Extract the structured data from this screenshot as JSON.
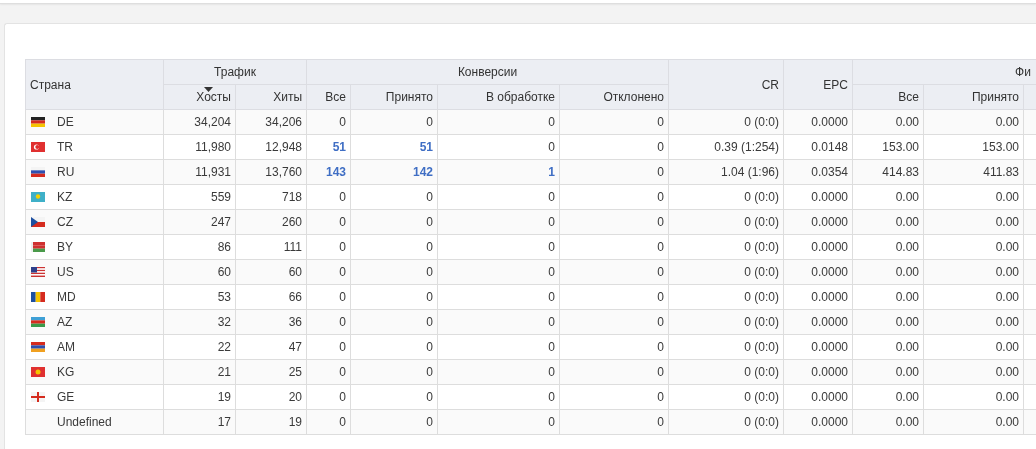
{
  "table": {
    "groups": [
      {
        "label": "Страна",
        "kind": "single"
      },
      {
        "label": "Трафик",
        "kind": "group"
      },
      {
        "label": "Конверсии",
        "kind": "group"
      },
      {
        "label": "CR",
        "kind": "single"
      },
      {
        "label": "EPC",
        "kind": "single"
      },
      {
        "label": "Фи",
        "kind": "group"
      }
    ],
    "columns": [
      {
        "label": "Хосты",
        "sorted": true
      },
      {
        "label": "Хиты",
        "sorted": false
      },
      {
        "label": "Все",
        "sorted": false
      },
      {
        "label": "Принято",
        "sorted": false
      },
      {
        "label": "В обработке",
        "sorted": false
      },
      {
        "label": "Отклонено",
        "sorted": false
      },
      {
        "label": "Все",
        "sorted": false
      },
      {
        "label": "Принято",
        "sorted": false
      }
    ],
    "rows": [
      {
        "country": "DE",
        "kind": "de",
        "hosts": "34,204",
        "hits": "34,206",
        "conversions": [
          {
            "text": "0",
            "link": false
          },
          {
            "text": "0",
            "link": false
          },
          {
            "text": "0",
            "link": false
          },
          {
            "text": "0",
            "link": false
          }
        ],
        "cr": "0 (0:0)",
        "epc": "0.0000",
        "finance": [
          "0.00",
          "0.00"
        ]
      },
      {
        "country": "TR",
        "kind": "tr",
        "hosts": "11,980",
        "hits": "12,948",
        "conversions": [
          {
            "text": "51",
            "link": true
          },
          {
            "text": "51",
            "link": true
          },
          {
            "text": "0",
            "link": false
          },
          {
            "text": "0",
            "link": false
          }
        ],
        "cr": "0.39 (1:254)",
        "epc": "0.0148",
        "finance": [
          "153.00",
          "153.00"
        ]
      },
      {
        "country": "RU",
        "kind": "ru",
        "hosts": "11,931",
        "hits": "13,760",
        "conversions": [
          {
            "text": "143",
            "link": true
          },
          {
            "text": "142",
            "link": true
          },
          {
            "text": "1",
            "link": true
          },
          {
            "text": "0",
            "link": false
          }
        ],
        "cr": "1.04 (1:96)",
        "epc": "0.0354",
        "finance": [
          "414.83",
          "411.83"
        ]
      },
      {
        "country": "KZ",
        "kind": "kz",
        "hosts": "559",
        "hits": "718",
        "conversions": [
          {
            "text": "0",
            "link": false
          },
          {
            "text": "0",
            "link": false
          },
          {
            "text": "0",
            "link": false
          },
          {
            "text": "0",
            "link": false
          }
        ],
        "cr": "0 (0:0)",
        "epc": "0.0000",
        "finance": [
          "0.00",
          "0.00"
        ]
      },
      {
        "country": "CZ",
        "kind": "cz",
        "hosts": "247",
        "hits": "260",
        "conversions": [
          {
            "text": "0",
            "link": false
          },
          {
            "text": "0",
            "link": false
          },
          {
            "text": "0",
            "link": false
          },
          {
            "text": "0",
            "link": false
          }
        ],
        "cr": "0 (0:0)",
        "epc": "0.0000",
        "finance": [
          "0.00",
          "0.00"
        ]
      },
      {
        "country": "BY",
        "kind": "by",
        "hosts": "86",
        "hits": "111",
        "conversions": [
          {
            "text": "0",
            "link": false
          },
          {
            "text": "0",
            "link": false
          },
          {
            "text": "0",
            "link": false
          },
          {
            "text": "0",
            "link": false
          }
        ],
        "cr": "0 (0:0)",
        "epc": "0.0000",
        "finance": [
          "0.00",
          "0.00"
        ]
      },
      {
        "country": "US",
        "kind": "us",
        "hosts": "60",
        "hits": "60",
        "conversions": [
          {
            "text": "0",
            "link": false
          },
          {
            "text": "0",
            "link": false
          },
          {
            "text": "0",
            "link": false
          },
          {
            "text": "0",
            "link": false
          }
        ],
        "cr": "0 (0:0)",
        "epc": "0.0000",
        "finance": [
          "0.00",
          "0.00"
        ]
      },
      {
        "country": "MD",
        "kind": "md",
        "hosts": "53",
        "hits": "66",
        "conversions": [
          {
            "text": "0",
            "link": false
          },
          {
            "text": "0",
            "link": false
          },
          {
            "text": "0",
            "link": false
          },
          {
            "text": "0",
            "link": false
          }
        ],
        "cr": "0 (0:0)",
        "epc": "0.0000",
        "finance": [
          "0.00",
          "0.00"
        ]
      },
      {
        "country": "AZ",
        "kind": "az",
        "hosts": "32",
        "hits": "36",
        "conversions": [
          {
            "text": "0",
            "link": false
          },
          {
            "text": "0",
            "link": false
          },
          {
            "text": "0",
            "link": false
          },
          {
            "text": "0",
            "link": false
          }
        ],
        "cr": "0 (0:0)",
        "epc": "0.0000",
        "finance": [
          "0.00",
          "0.00"
        ]
      },
      {
        "country": "AM",
        "kind": "am",
        "hosts": "22",
        "hits": "47",
        "conversions": [
          {
            "text": "0",
            "link": false
          },
          {
            "text": "0",
            "link": false
          },
          {
            "text": "0",
            "link": false
          },
          {
            "text": "0",
            "link": false
          }
        ],
        "cr": "0 (0:0)",
        "epc": "0.0000",
        "finance": [
          "0.00",
          "0.00"
        ]
      },
      {
        "country": "KG",
        "kind": "kg",
        "hosts": "21",
        "hits": "25",
        "conversions": [
          {
            "text": "0",
            "link": false
          },
          {
            "text": "0",
            "link": false
          },
          {
            "text": "0",
            "link": false
          },
          {
            "text": "0",
            "link": false
          }
        ],
        "cr": "0 (0:0)",
        "epc": "0.0000",
        "finance": [
          "0.00",
          "0.00"
        ]
      },
      {
        "country": "GE",
        "kind": "ge",
        "hosts": "19",
        "hits": "20",
        "conversions": [
          {
            "text": "0",
            "link": false
          },
          {
            "text": "0",
            "link": false
          },
          {
            "text": "0",
            "link": false
          },
          {
            "text": "0",
            "link": false
          }
        ],
        "cr": "0 (0:0)",
        "epc": "0.0000",
        "finance": [
          "0.00",
          "0.00"
        ]
      },
      {
        "country": "Undefined",
        "kind": "none",
        "hosts": "17",
        "hits": "19",
        "conversions": [
          {
            "text": "0",
            "link": false
          },
          {
            "text": "0",
            "link": false
          },
          {
            "text": "0",
            "link": false
          },
          {
            "text": "0",
            "link": false
          }
        ],
        "cr": "0 (0:0)",
        "epc": "0.0000",
        "finance": [
          "0.00",
          "0.00"
        ]
      }
    ]
  }
}
